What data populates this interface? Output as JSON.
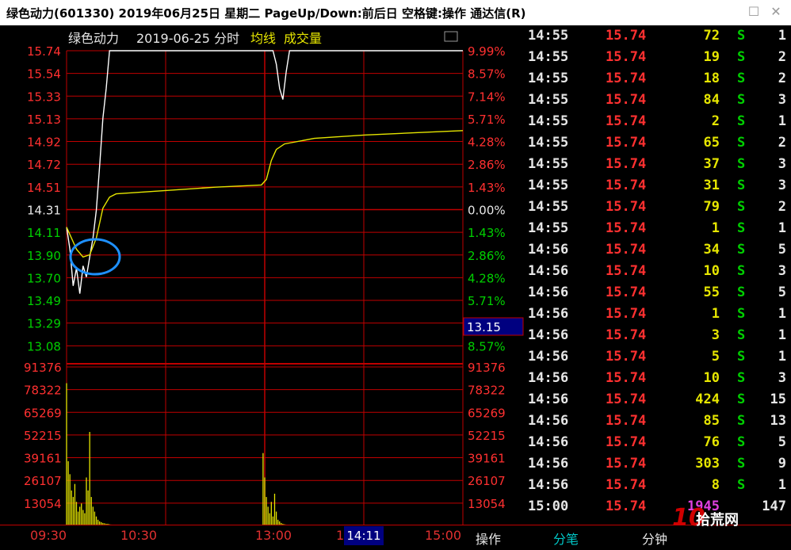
{
  "window": {
    "title": "绿色动力(601330) 2019年06月25日 星期二 PageUp/Down:前后日 空格键:操作 通达信(R)"
  },
  "chart_header": {
    "name": "绿色动力",
    "date_label": "2019-06-25 分时",
    "avg_label": "均线",
    "vol_label": "成交量"
  },
  "bottom": {
    "time_labels": [
      "09:30",
      "10:30",
      "13:00",
      "14",
      "15:00"
    ],
    "cursor_time": "14:11",
    "tab_op": "操作",
    "tab_trades": "分笔",
    "tab_minute": "分钟"
  },
  "price_cursor": "13.15",
  "chart_data": {
    "type": "line",
    "title": "绿色动力 2019-06-25 分时",
    "prev_close": 14.31,
    "price_ticks": [
      "15.74",
      "15.54",
      "15.33",
      "15.13",
      "14.92",
      "14.72",
      "14.51",
      "14.31",
      "14.11",
      "13.90",
      "13.70",
      "13.49",
      "13.29",
      "13.08"
    ],
    "pct_ticks": [
      "9.99%",
      "8.57%",
      "7.14%",
      "5.71%",
      "4.28%",
      "2.86%",
      "1.43%",
      "0.00%",
      "1.43%",
      "2.86%",
      "4.28%",
      "5.71%",
      "",
      "8.57%"
    ],
    "volume_ticks": [
      "91376",
      "78322",
      "65269",
      "52215",
      "39161",
      "26107",
      "13054"
    ],
    "ylim": [
      13.0,
      15.74
    ],
    "volume_ylim": [
      0,
      98000
    ],
    "series": [
      {
        "name": "价格",
        "points": [
          [
            0,
            14.15
          ],
          [
            2,
            13.95
          ],
          [
            4,
            13.62
          ],
          [
            6,
            13.78
          ],
          [
            8,
            13.55
          ],
          [
            10,
            13.8
          ],
          [
            12,
            13.7
          ],
          [
            14,
            13.88
          ],
          [
            16,
            14.05
          ],
          [
            18,
            14.3
          ],
          [
            20,
            14.7
          ],
          [
            22,
            15.13
          ],
          [
            24,
            15.4
          ],
          [
            26,
            15.74
          ],
          [
            30,
            15.74
          ],
          [
            60,
            15.74
          ],
          [
            90,
            15.74
          ],
          [
            120,
            15.74
          ],
          [
            125,
            15.74
          ],
          [
            127,
            15.62
          ],
          [
            129,
            15.4
          ],
          [
            131,
            15.3
          ],
          [
            133,
            15.55
          ],
          [
            135,
            15.74
          ],
          [
            150,
            15.74
          ],
          [
            180,
            15.74
          ],
          [
            210,
            15.74
          ],
          [
            240,
            15.74
          ]
        ]
      },
      {
        "name": "均线",
        "points": [
          [
            0,
            14.15
          ],
          [
            6,
            13.95
          ],
          [
            10,
            13.88
          ],
          [
            14,
            13.9
          ],
          [
            18,
            14.05
          ],
          [
            22,
            14.32
          ],
          [
            26,
            14.42
          ],
          [
            30,
            14.45
          ],
          [
            60,
            14.48
          ],
          [
            90,
            14.51
          ],
          [
            118,
            14.53
          ],
          [
            121,
            14.58
          ],
          [
            124,
            14.75
          ],
          [
            127,
            14.85
          ],
          [
            132,
            14.9
          ],
          [
            150,
            14.95
          ],
          [
            180,
            14.98
          ],
          [
            210,
            15.0
          ],
          [
            240,
            15.02
          ]
        ]
      }
    ],
    "volume": [
      88000,
      40000,
      32000,
      22000,
      18000,
      26000,
      15000,
      9000,
      12000,
      14000,
      10000,
      8000,
      30000,
      22000,
      58000,
      18000,
      12000,
      9000,
      6000,
      4000,
      3000,
      2500,
      2000,
      1800,
      1500,
      1500,
      1200,
      1000,
      900,
      800,
      700,
      600,
      500,
      500,
      400,
      400,
      300,
      300,
      300,
      300,
      300,
      300,
      300,
      300,
      300,
      300,
      300,
      300,
      300,
      300,
      300,
      300,
      300,
      300,
      300,
      300,
      300,
      300,
      300,
      300,
      300,
      300,
      300,
      300,
      300,
      300,
      300,
      300,
      300,
      300,
      300,
      300,
      300,
      300,
      300,
      300,
      300,
      300,
      300,
      300,
      300,
      300,
      300,
      300,
      300,
      300,
      300,
      300,
      300,
      300,
      300,
      300,
      300,
      300,
      300,
      300,
      300,
      300,
      300,
      300,
      300,
      300,
      300,
      300,
      300,
      300,
      300,
      300,
      300,
      300,
      300,
      300,
      300,
      300,
      300,
      300,
      300,
      300,
      300,
      45000,
      30000,
      18000,
      12000,
      8000,
      15000,
      6000,
      20000,
      9000,
      4000,
      3000,
      2000,
      1500,
      1200,
      1000,
      900,
      800,
      700,
      600,
      500,
      400,
      400,
      300,
      300,
      300,
      300,
      300,
      300,
      300,
      300,
      300,
      300,
      300,
      300,
      300,
      300,
      300,
      300,
      300,
      300,
      300,
      300,
      300,
      300,
      300,
      300,
      300,
      300,
      300,
      300,
      300,
      300,
      300,
      300,
      300,
      300,
      300,
      300,
      300,
      300,
      300,
      300,
      300,
      300,
      300,
      300,
      300,
      300,
      300,
      300,
      300,
      300,
      300,
      300,
      300,
      300,
      300,
      300,
      300,
      300,
      300,
      300,
      300,
      300,
      300,
      300,
      300,
      300,
      300,
      300,
      300,
      300,
      300,
      300,
      300,
      300,
      300,
      300,
      300,
      300,
      300,
      300,
      300,
      300,
      300,
      300,
      300,
      300,
      300,
      300,
      300,
      300,
      300,
      300,
      300,
      300,
      300,
      300,
      300,
      300,
      300,
      300,
      300,
      300,
      300,
      300
    ],
    "colors": {
      "price": "#ffffff",
      "avg": "#e6e600",
      "volume": "#e6e600",
      "grid": "#c00000",
      "up": "#ff3030",
      "down": "#00d000",
      "circle": "#1e90ff"
    }
  },
  "trades": [
    {
      "time": "14:55",
      "price": "15.74",
      "vol": "72",
      "side": "S",
      "n": "1"
    },
    {
      "time": "14:55",
      "price": "15.74",
      "vol": "19",
      "side": "S",
      "n": "2"
    },
    {
      "time": "14:55",
      "price": "15.74",
      "vol": "18",
      "side": "S",
      "n": "2"
    },
    {
      "time": "14:55",
      "price": "15.74",
      "vol": "84",
      "side": "S",
      "n": "3"
    },
    {
      "time": "14:55",
      "price": "15.74",
      "vol": "2",
      "side": "S",
      "n": "1"
    },
    {
      "time": "14:55",
      "price": "15.74",
      "vol": "65",
      "side": "S",
      "n": "2"
    },
    {
      "time": "14:55",
      "price": "15.74",
      "vol": "37",
      "side": "S",
      "n": "3"
    },
    {
      "time": "14:55",
      "price": "15.74",
      "vol": "31",
      "side": "S",
      "n": "3"
    },
    {
      "time": "14:55",
      "price": "15.74",
      "vol": "79",
      "side": "S",
      "n": "2"
    },
    {
      "time": "14:55",
      "price": "15.74",
      "vol": "1",
      "side": "S",
      "n": "1"
    },
    {
      "time": "14:56",
      "price": "15.74",
      "vol": "34",
      "side": "S",
      "n": "5"
    },
    {
      "time": "14:56",
      "price": "15.74",
      "vol": "10",
      "side": "S",
      "n": "3"
    },
    {
      "time": "14:56",
      "price": "15.74",
      "vol": "55",
      "side": "S",
      "n": "5"
    },
    {
      "time": "14:56",
      "price": "15.74",
      "vol": "1",
      "side": "S",
      "n": "1"
    },
    {
      "time": "14:56",
      "price": "15.74",
      "vol": "3",
      "side": "S",
      "n": "1"
    },
    {
      "time": "14:56",
      "price": "15.74",
      "vol": "5",
      "side": "S",
      "n": "1"
    },
    {
      "time": "14:56",
      "price": "15.74",
      "vol": "10",
      "side": "S",
      "n": "3"
    },
    {
      "time": "14:56",
      "price": "15.74",
      "vol": "424",
      "side": "S",
      "n": "15"
    },
    {
      "time": "14:56",
      "price": "15.74",
      "vol": "85",
      "side": "S",
      "n": "13"
    },
    {
      "time": "14:56",
      "price": "15.74",
      "vol": "76",
      "side": "S",
      "n": "5"
    },
    {
      "time": "14:56",
      "price": "15.74",
      "vol": "303",
      "side": "S",
      "n": "9"
    },
    {
      "time": "14:56",
      "price": "15.74",
      "vol": "8",
      "side": "S",
      "n": "1"
    },
    {
      "time": "15:00",
      "price": "15.74",
      "vol": "1945",
      "side": "",
      "n": "147"
    }
  ],
  "watermark": {
    "text1": "10",
    "text2": "拾荒网"
  }
}
